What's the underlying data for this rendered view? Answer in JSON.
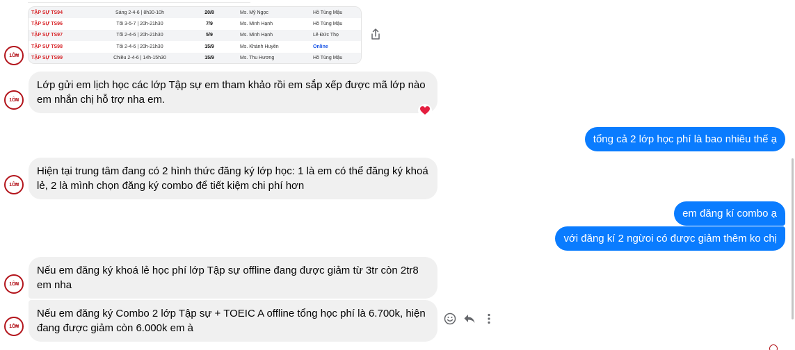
{
  "schedule": {
    "rows": [
      {
        "code": "TẬP SỰ TS94",
        "time": "Sáng 2-4-6 | 8h30-10h",
        "date": "20/8",
        "teacher": "Ms. Mỹ Ngọc",
        "place": "Hồ Tùng Mậu"
      },
      {
        "code": "TẬP SỰ TS96",
        "time": "Tối 3-5-7 | 20h-21h30",
        "date": "7/9",
        "teacher": "Ms. Minh Hạnh",
        "place": "Hồ Tùng Mậu"
      },
      {
        "code": "TẬP SỰ TS97",
        "time": "Tối 2-4-6 | 20h-21h30",
        "date": "5/9",
        "teacher": "Ms. Minh Hạnh",
        "place": "Lê Đức Thọ"
      },
      {
        "code": "TẬP SỰ TS98",
        "time": "Tối 2-4-6 | 20h-21h30",
        "date": "15/9",
        "teacher": "Ms. Khánh Huyền",
        "place": "Online"
      },
      {
        "code": "TẬP SỰ TS99",
        "time": "Chiều 2-4-6 | 14h-15h30",
        "date": "15/9",
        "teacher": "Ms. Thu Hương",
        "place": "Hồ Tùng Mậu"
      }
    ]
  },
  "messages": {
    "in_1": "Lớp gửi em lịch học các lớp Tập sự em tham khảo rồi em sắp xếp được mã lớp nào em nhắn chị hỗ trợ nha em.",
    "out_1": "tổng cả 2 lớp học phí là bao nhiêu thế ạ",
    "in_2": "Hiện tại trung tâm đang có 2 hình thức đăng ký lớp học: 1 là em có thể đăng ký khoá lẻ, 2 là mình chọn đăng ký combo để tiết kiệm chi phí hơn",
    "out_2": "em đăng kí combo ạ",
    "out_3": "với đăng kí 2 ngừoi có được giảm thêm ko chị",
    "in_3": "Nếu em đăng ký khoá lẻ học phí lớp Tập sự offline đang được giảm từ 3tr còn 2tr8 em nha",
    "in_4": "Nếu em đăng ký Combo 2 lớp Tập sự + TOEIC A offline tổng học phí là 6.700k, hiện đang được giảm còn 6.000k em à"
  },
  "avatar": {
    "logo_text": "1Ô₦"
  },
  "reaction": {
    "icon": "heart-icon",
    "color": "#e41e3f"
  },
  "colors": {
    "outgoing": "#0a7cff",
    "incoming": "#f0f0f0",
    "brand": "#b3151c"
  },
  "icons": [
    "share-icon",
    "smiley-icon",
    "reply-icon",
    "more-icon"
  ]
}
